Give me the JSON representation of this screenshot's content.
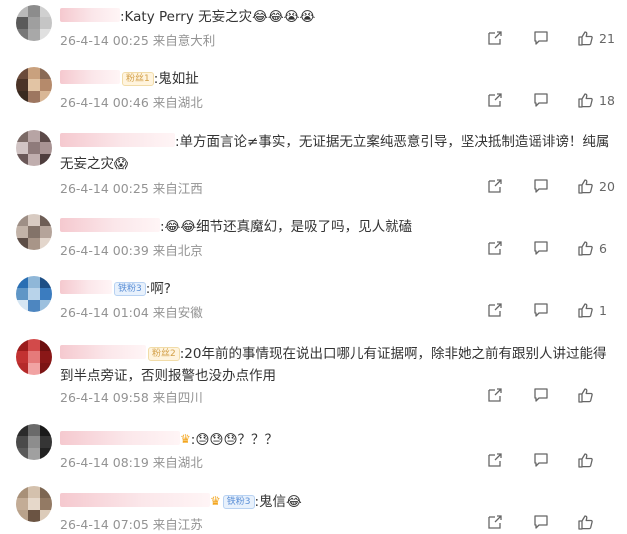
{
  "comments": [
    {
      "text": ":Katy Perry 无妄之灾😂😂😭😭",
      "time": "26-4-14 00:25",
      "location": "来自意大利",
      "likes": "21",
      "name_w": 60,
      "badge": "",
      "colors": [
        "#b9b9b9",
        "#8c8c8c",
        "#d0d0d0",
        "#5a5a5a",
        "#9f9f9f",
        "#c5c5c5",
        "#777",
        "#a8a8a8",
        "#e0e0e0"
      ]
    },
    {
      "text": ":鬼如扯",
      "time": "26-4-14 00:46",
      "location": "来自湖北",
      "likes": "18",
      "name_w": 60,
      "badge": "gold",
      "badge_text": "粉丝1",
      "colors": [
        "#6b4b3b",
        "#c9a17e",
        "#8a6a55",
        "#4b3327",
        "#e2c4a4",
        "#b58a6b",
        "#3a2a20",
        "#9d7660",
        "#d9b796"
      ]
    },
    {
      "text": ":单方面言论≠事实，无证据无立案纯恶意引导，坚决抵制造谣诽谤！纯属无妄之灾😱",
      "time": "26-4-14 00:25",
      "location": "来自江西",
      "likes": "20",
      "name_w": 115,
      "badge": "",
      "colors": [
        "#7b6a66",
        "#b7a4a4",
        "#5c4a49",
        "#d1c4c4",
        "#8f7b7b",
        "#a89393",
        "#6a5858",
        "#c0aeae",
        "#4e3d3d"
      ]
    },
    {
      "text": ":😂😂细节还真魔幻，是吸了吗，见人就磕",
      "time": "26-4-14 00:39",
      "location": "来自北京",
      "likes": "6",
      "name_w": 100,
      "badge": "",
      "colors": [
        "#9e8f86",
        "#d8cbc2",
        "#6e5e56",
        "#c2b3a8",
        "#837369",
        "#b5a49a",
        "#5c4d46",
        "#a89588",
        "#e3d6cc"
      ]
    },
    {
      "text": ":啊?",
      "time": "26-4-14 01:04",
      "location": "来自安徽",
      "likes": "1",
      "name_w": 52,
      "badge": "blue",
      "badge_text": "铁粉3",
      "colors": [
        "#2a6fb3",
        "#8fb7d8",
        "#1e4f86",
        "#5f96c6",
        "#b8d3ea",
        "#3b7cbf",
        "#d6e6f3",
        "#4d86c0",
        "#9cc0de"
      ]
    },
    {
      "text": ":20年前的事情现在说出口哪儿有证据啊，除非她之前有跟别人讲过能得到半点旁证，否则报警也没办点作用",
      "time": "26-4-14 09:58",
      "location": "来自四川",
      "likes": "",
      "name_w": 86,
      "badge": "gold",
      "badge_text": "粉丝2",
      "colors": [
        "#9b1c1c",
        "#d24a4a",
        "#6d1010",
        "#c23232",
        "#e57a7a",
        "#8a1717",
        "#b52a2a",
        "#f1a3a3",
        "#7c1414"
      ]
    },
    {
      "text": ":😓😓😓？？？",
      "time": "26-4-14 08:19",
      "location": "来自湖北",
      "likes": "",
      "name_w": 120,
      "badge": "crown",
      "colors": [
        "#2b2b2b",
        "#6a6a6a",
        "#1a1a1a",
        "#4a4a4a",
        "#8d8d8d",
        "#353535",
        "#5a5a5a",
        "#a0a0a0",
        "#222"
      ]
    },
    {
      "text": ":鬼信😂",
      "time": "26-4-14 07:05",
      "location": "来自江苏",
      "likes": "",
      "name_w": 150,
      "badge": "blue",
      "badge_text": "铁粉3",
      "crown": true,
      "colors": [
        "#a89078",
        "#d4c1ad",
        "#7d6652",
        "#c3ac96",
        "#e6d8ca",
        "#937a64",
        "#b9a28b",
        "#6b5443",
        "#dccbb9"
      ]
    }
  ]
}
